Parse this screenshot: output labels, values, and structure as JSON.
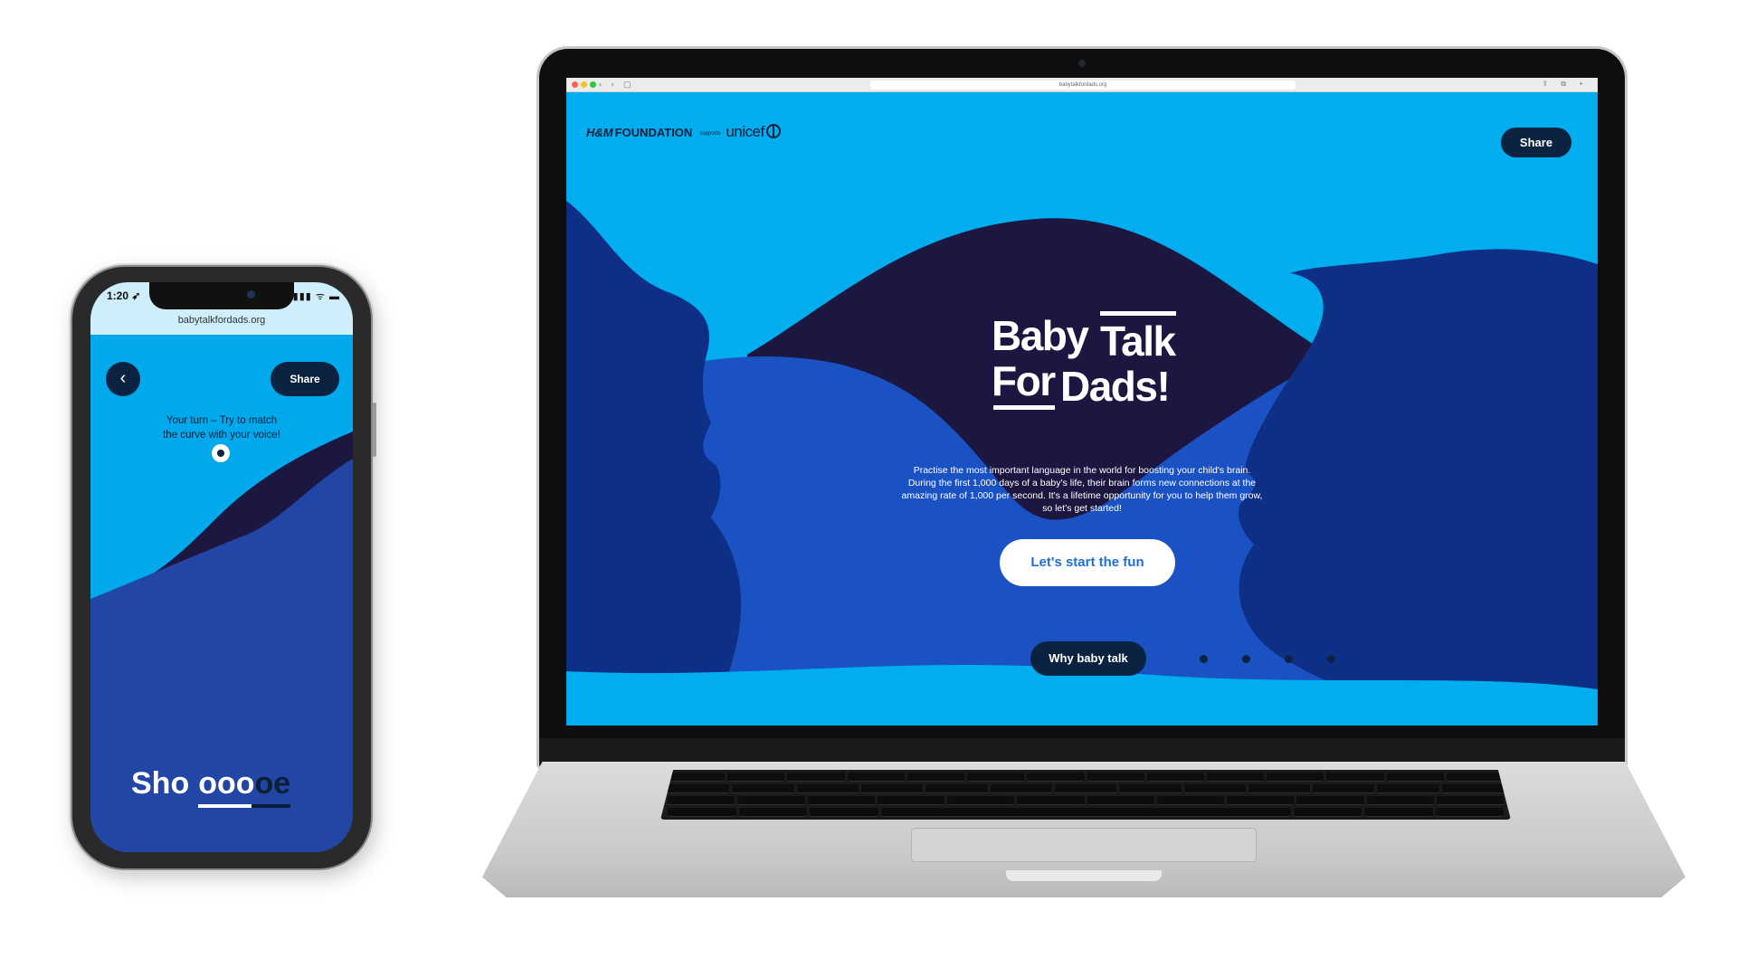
{
  "phone": {
    "status_time": "1:20 ➶",
    "status_icons": "▮▮▮ ᯤ ▬",
    "url": "babytalkfordads.org",
    "back_icon": "chevron-left-icon",
    "back_glyph": "‹",
    "share_label": "Share",
    "instruction_line1": "Your turn – Try to match",
    "instruction_line2": "the curve with your voice!",
    "word_prefix": "Sho",
    "word_sound_a": "ooo",
    "word_sound_b": "oe",
    "sound_progress": 0.58
  },
  "laptop": {
    "browser": {
      "url": "babytalkfordads.org",
      "nav_glyphs": "‹ › ▢",
      "right_glyphs": "⇪ ⧉ +"
    },
    "site": {
      "brand_hm": "H&M",
      "brand_foundation": "FOUNDATION",
      "brand_supports": "supports",
      "brand_unicef": "unicef",
      "share_label": "Share",
      "logo_baby": "Baby",
      "logo_talk": "Talk",
      "logo_for": "For",
      "logo_dads": "Dads!",
      "intro_text": "Practise the most important language in the world for boosting your child's brain. During the first 1,000 days of a baby's life, their brain forms new connections at the amazing rate of 1,000 per second. It's a lifetime opportunity for you to help them grow, so let's get started!",
      "cta_label": "Let's start the fun",
      "why_label": "Why baby talk",
      "pager_count": 4
    }
  },
  "colors": {
    "sky_blue": "#00adef",
    "mid_blue": "#1a52c4",
    "royal_blue": "#0f3fa8",
    "dark_navy": "#1b1740",
    "button_navy": "#0b2340",
    "cta_text": "#1f6fd6"
  }
}
